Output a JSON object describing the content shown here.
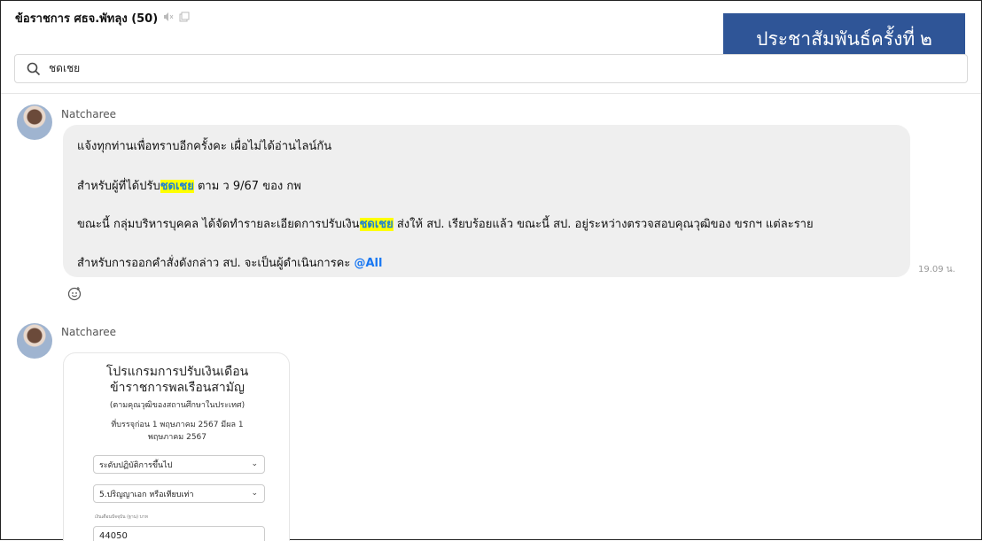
{
  "header": {
    "title": "ข้อราชการ ศธจ.พัทลุง (50)",
    "mute_icon": "speaker-muted-icon",
    "window_icon": "popout-icon"
  },
  "banner": {
    "text": "ประชาสัมพันธ์ครั้งที่ ๒"
  },
  "search": {
    "icon": "search-icon",
    "value": "ชดเชย"
  },
  "messages": [
    {
      "sender": "Natcharee",
      "lines": {
        "l1": "แจ้งทุกท่านเพื่อทราบอีกครั้งคะ เผื่อไม่ได้อ่านไลน์กัน",
        "l2_pre": "สำหรับผู้ที่ได้ปรับ",
        "l2_hl": "ชดเชย",
        "l2_post": "  ตาม ว 9/67 ของ กพ",
        "l3_pre": "ขณะนี้ กลุ่มบริหารบุคคล ได้จัดทำรายละเอียดการปรับเงิน",
        "l3_hl": "ชดเชย",
        "l3_post": " ส่งให้ สป. เรียบร้อยแล้ว ขณะนี้ สป. อยู่ระหว่างตรวจสอบคุณวุฒิของ ขรกฯ แต่ละราย",
        "l4_pre": "สำหรับการออกคำสั่งดังกล่าว สป. จะเป็นผู้ดำเนินการคะ ",
        "l4_mention": "@All"
      },
      "time": "19.09 น.",
      "reaction_icon": "add-reaction-icon"
    },
    {
      "sender": "Natcharee",
      "card": {
        "title1": "โปรแกรมการปรับเงินเดือน",
        "title2": "ข้าราชการพลเรือนสามัญ",
        "sub1": "(ตามคุณวุฒิของสถานศึกษาในประเทศ)",
        "sub2": "ที่บรรจุก่อน 1 พฤษภาคม 2567 มีผล 1",
        "sub3": "พฤษภาคม 2567",
        "select1": "ระดับปฏิบัติการขึ้นไป",
        "select2": "5.ปริญญาเอก หรือเทียบเท่า",
        "input_label": "เงินเดือนปัจจุบัน (ฐาน) บาท",
        "input_value": "44050"
      }
    }
  ]
}
